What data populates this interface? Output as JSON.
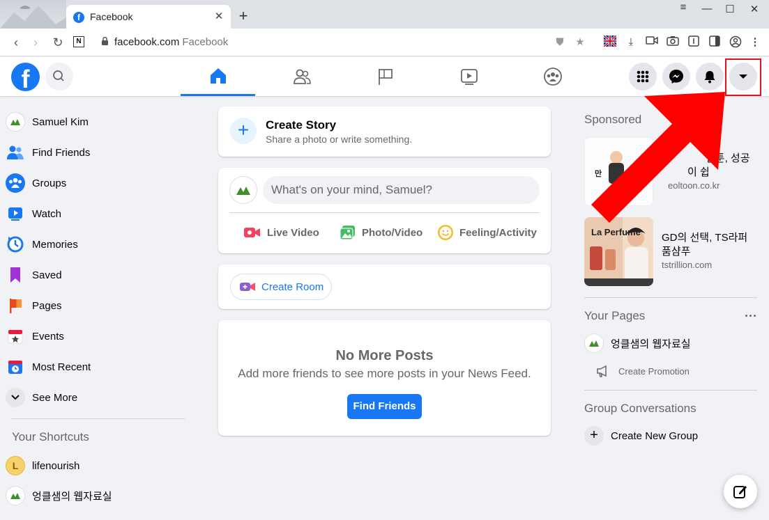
{
  "browser": {
    "tab_title": "Facebook",
    "tab_favicon": "f",
    "url_domain": "facebook.com",
    "url_site": "Facebook"
  },
  "fb": {
    "nav_tabs": [
      "home",
      "friends",
      "pages",
      "watch",
      "groups"
    ],
    "active_tab": "home"
  },
  "left_sidebar": {
    "items": [
      {
        "label": "Samuel Kim",
        "icon": "profile-avatar"
      },
      {
        "label": "Find Friends",
        "icon": "friends-icon"
      },
      {
        "label": "Groups",
        "icon": "groups-icon"
      },
      {
        "label": "Watch",
        "icon": "watch-icon"
      },
      {
        "label": "Memories",
        "icon": "memories-icon"
      },
      {
        "label": "Saved",
        "icon": "saved-icon"
      },
      {
        "label": "Pages",
        "icon": "pages-icon"
      },
      {
        "label": "Events",
        "icon": "events-icon"
      },
      {
        "label": "Most Recent",
        "icon": "most-recent-icon"
      },
      {
        "label": "See More",
        "icon": "chevron-down-icon"
      }
    ],
    "shortcuts_title": "Your Shortcuts",
    "shortcuts": [
      {
        "label": "lifenourish",
        "initial": "L"
      },
      {
        "label": "엉클샘의 웹자료실"
      }
    ]
  },
  "feed": {
    "story_title": "Create Story",
    "story_sub": "Share a photo or write something.",
    "composer_placeholder": "What's on your mind, Samuel?",
    "actions": [
      "Live Video",
      "Photo/Video",
      "Feeling/Activity"
    ],
    "room_label": "Create Room",
    "nmp_title": "No More Posts",
    "nmp_sub": "Add more friends to see more posts in your News Feed.",
    "find_friends": "Find Friends"
  },
  "right_sidebar": {
    "sponsored": "Sponsored",
    "ads": [
      {
        "title": "만화 웹툰, 성공",
        "domain": "deoltoon.co.kr",
        "title_visible": "벌툰, 성공",
        "title_line2": "이 쉽",
        "domain_visible": "eoltoon.co.kr"
      },
      {
        "title": "GD의 선택, TS라퍼품샴푸",
        "domain": "tstrillion.com",
        "title_l1": "GD의 선택, TS라퍼",
        "title_l2": "품샴푸",
        "brand": "La Perfume"
      }
    ],
    "your_pages": "Your Pages",
    "page_name": "엉클샘의 웹자료실",
    "create_promotion": "Create Promotion",
    "group_conv": "Group Conversations",
    "create_group": "Create New Group"
  },
  "colors": {
    "fb_blue": "#1877f2",
    "highlight_red": "#e0141e",
    "arrow_red": "#ff0000"
  }
}
